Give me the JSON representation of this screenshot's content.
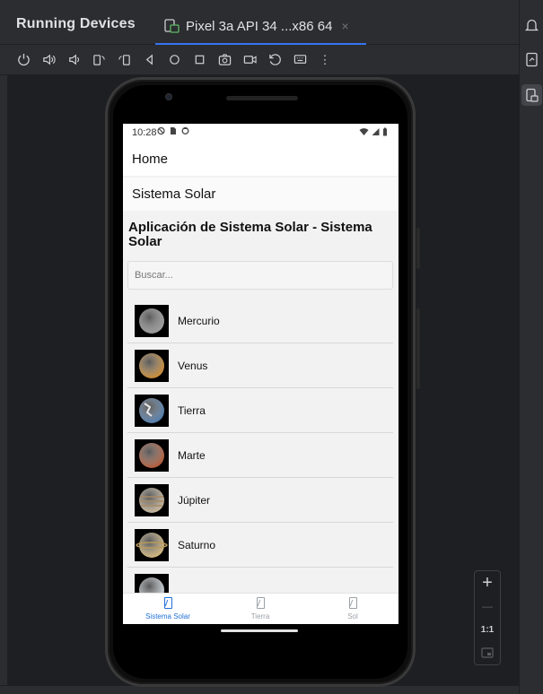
{
  "ide": {
    "panel_title": "Running Devices",
    "tab_label": "Pixel 3a API 34 ...x86 64",
    "tab_close": "×",
    "toolbar_icons": [
      "power-icon",
      "volume-up-icon",
      "volume-down-icon",
      "rotate-left-icon",
      "rotate-right-icon",
      "back-icon",
      "home-icon",
      "overview-icon",
      "screenshot-icon",
      "screen-record-icon",
      "reset-icon",
      "keyboard-icon",
      "more-icon"
    ],
    "more_label": "⋮",
    "zoom": {
      "plus": "+",
      "minus": "—",
      "ratio": "1:1"
    },
    "colors": {
      "accent": "#3574f0",
      "panel_bg": "#2b2d30",
      "viewport_bg": "#1e1f22"
    }
  },
  "phone": {
    "status": {
      "time": "10:28"
    },
    "drawer": {
      "home": "Home",
      "sistema": "Sistema Solar"
    },
    "app": {
      "title": "Aplicación de Sistema Solar - Sistema Solar",
      "search_placeholder": "Buscar...",
      "planets": [
        {
          "name": "Mercurio",
          "color": "#9a9a9a"
        },
        {
          "name": "Venus",
          "color": "#d08a2a"
        },
        {
          "name": "Tierra",
          "color": "#4a7ab0"
        },
        {
          "name": "Marte",
          "color": "#b5552f"
        },
        {
          "name": "Júpiter",
          "color": "#c9b89a"
        },
        {
          "name": "Saturno",
          "color": "#d6b778"
        }
      ],
      "partial_planet_color": "#cfd8df"
    },
    "nav": [
      {
        "label": "Sistema Solar",
        "active": true
      },
      {
        "label": "Tierra",
        "active": false
      },
      {
        "label": "Sol",
        "active": false
      }
    ],
    "colors": {
      "nav_active": "#1f6fd6",
      "nav_inactive": "#9aa0a6"
    }
  }
}
